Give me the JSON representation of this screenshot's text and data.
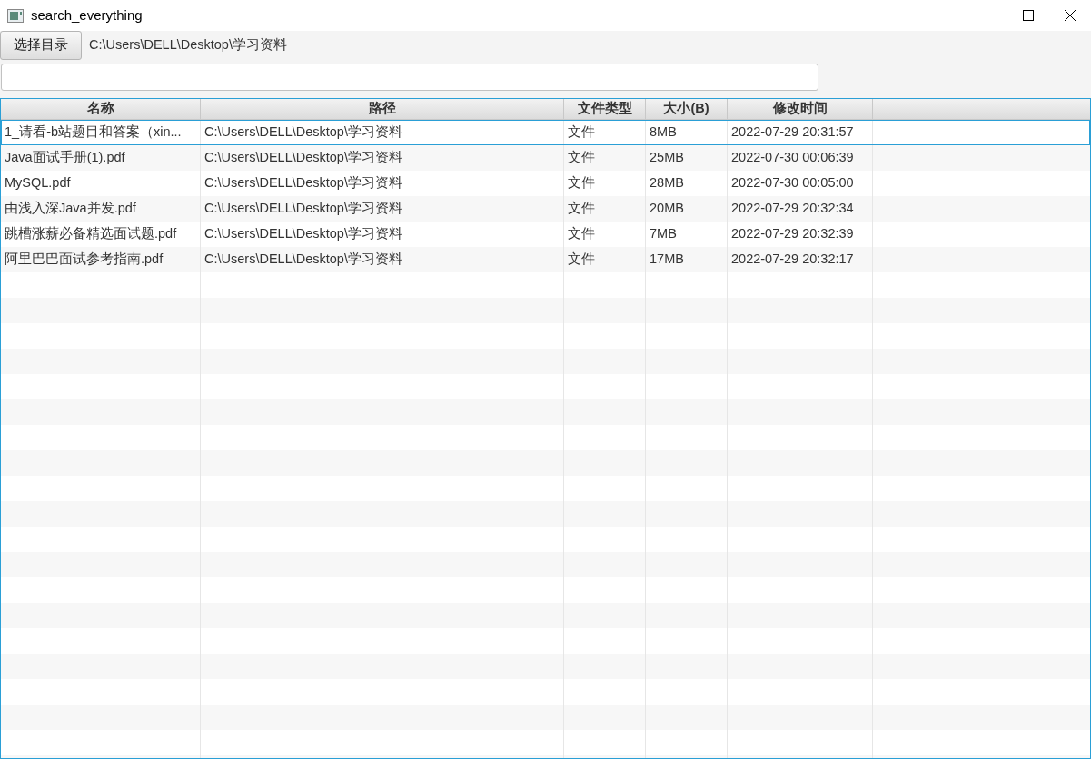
{
  "window": {
    "title": "search_everything"
  },
  "toolbar": {
    "button": "选择目录",
    "path": "C:\\Users\\DELL\\Desktop\\学习资料"
  },
  "table": {
    "columns": [
      "名称",
      "路径",
      "文件类型",
      "大小(B)",
      "修改时间"
    ],
    "rows": [
      {
        "cells": [
          "1_请看-b站题目和答案（xin...",
          "C:\\Users\\DELL\\Desktop\\学习资料",
          "文件",
          "8MB",
          "2022-07-29 20:31:57"
        ],
        "selected": true
      },
      {
        "cells": [
          "Java面试手册(1).pdf",
          "C:\\Users\\DELL\\Desktop\\学习资料",
          "文件",
          "25MB",
          "2022-07-30 00:06:39"
        ],
        "selected": false
      },
      {
        "cells": [
          "MySQL.pdf",
          "C:\\Users\\DELL\\Desktop\\学习资料",
          "文件",
          "28MB",
          "2022-07-30 00:05:00"
        ],
        "selected": false
      },
      {
        "cells": [
          "由浅入深Java并发.pdf",
          "C:\\Users\\DELL\\Desktop\\学习资料",
          "文件",
          "20MB",
          "2022-07-29 20:32:34"
        ],
        "selected": false
      },
      {
        "cells": [
          "跳槽涨薪必备精选面试题.pdf",
          "C:\\Users\\DELL\\Desktop\\学习资料",
          "文件",
          "7MB",
          "2022-07-29 20:32:39"
        ],
        "selected": false
      },
      {
        "cells": [
          "阿里巴巴面试参考指南.pdf",
          "C:\\Users\\DELL\\Desktop\\学习资料",
          "文件",
          "17MB",
          "2022-07-29 20:32:17"
        ],
        "selected": false
      }
    ]
  }
}
